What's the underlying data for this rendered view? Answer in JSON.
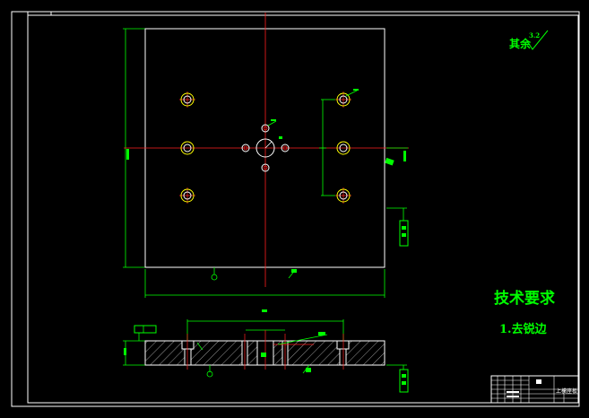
{
  "colors": {
    "background": "#000000",
    "outline": "#ffffff",
    "centerline": "#ff2020",
    "dimension": "#00ff00",
    "hole_outer": "#ffff00"
  },
  "roughness_note": "其余",
  "roughness_value": "3.2",
  "tech_title": "技术要求",
  "tech_items": [
    "1.去锐边"
  ],
  "title_block": {
    "name_cell": "上模座板"
  }
}
